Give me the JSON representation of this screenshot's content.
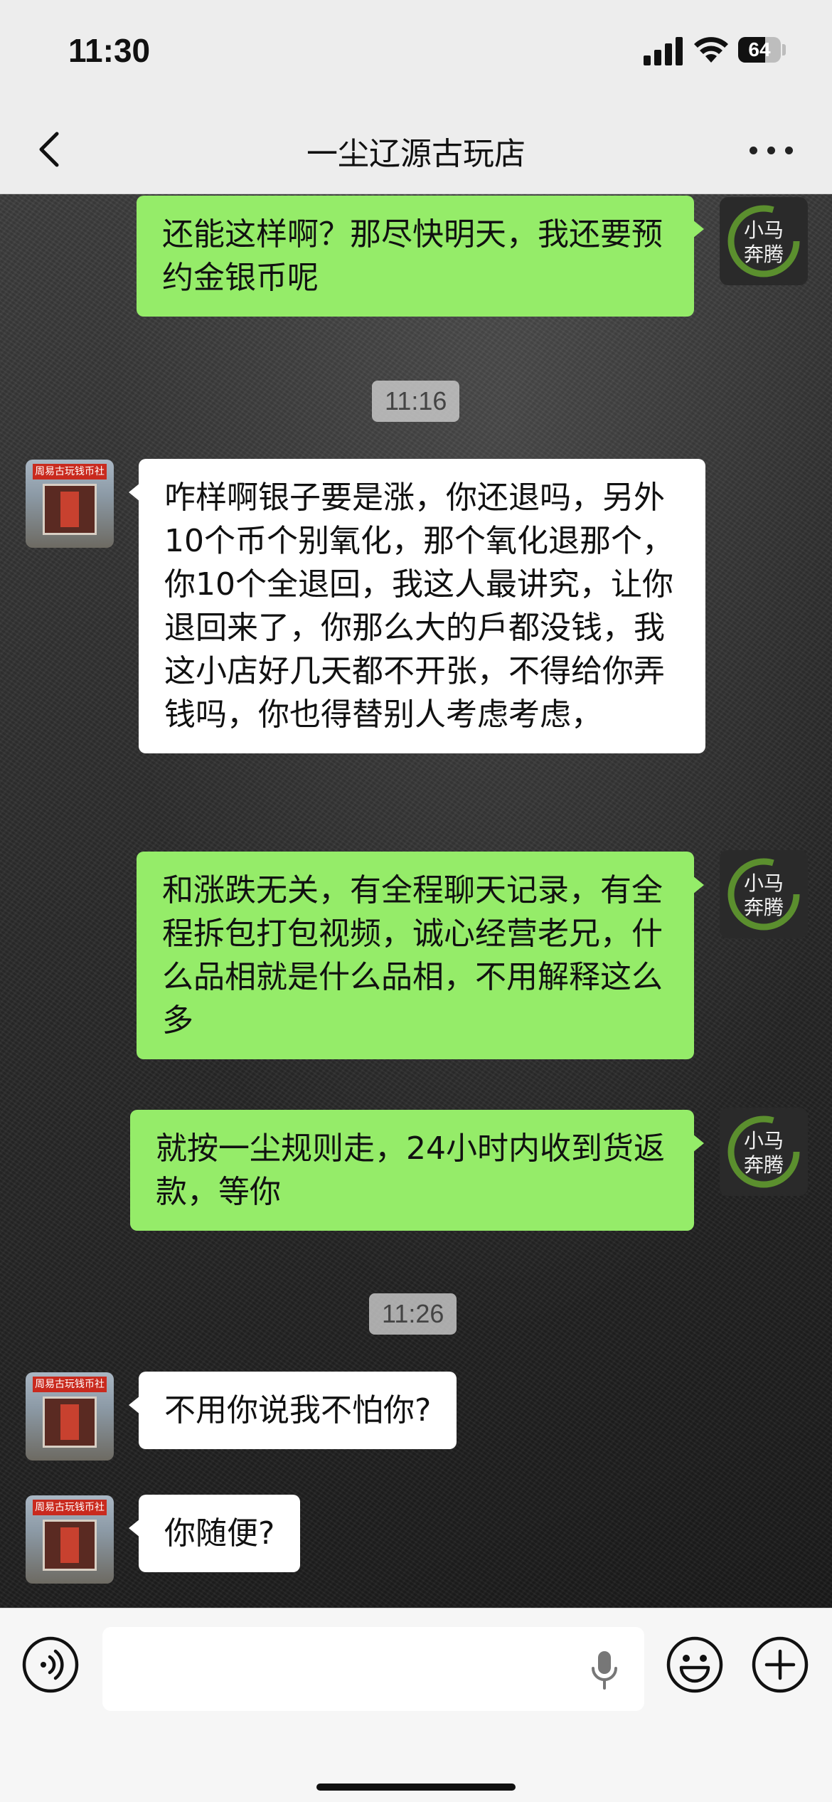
{
  "status_bar": {
    "time": "11:30",
    "battery_level": "64",
    "battery_fraction": 0.64
  },
  "header": {
    "title": "一尘辽源古玩店"
  },
  "colors": {
    "outgoing_bubble": "#95ec69",
    "incoming_bubble": "#ffffff",
    "timestamp_bg": "#d2d2d2",
    "avatar_ring": "#5b8f2e",
    "shop_sign": "#c92a1e"
  },
  "avatars": {
    "me": {
      "text_line1": "小马",
      "text_line2": "奔腾",
      "icon": "ink-circle-avatar"
    },
    "shop": {
      "sign": "周易古玩钱币社",
      "icon": "storefront-photo"
    }
  },
  "messages": [
    {
      "side": "out",
      "text": "还能这样啊？那尽快明天，我还要预约金银币呢"
    },
    {
      "side": "time",
      "text": "11:16"
    },
    {
      "side": "in",
      "text": "咋样啊银子要是涨，你还退吗，另外10个币个别氧化，那个氧化退那个，你10个全退回，我这人最讲究，让你退回来了，你那么大的戶都没钱，我这小店好几天都不开张，不得给你弄钱吗，你也得替别人考虑考虑，"
    },
    {
      "side": "out",
      "text": "和涨跌无关，有全程聊天记录，有全程拆包打包视频，诚心经营老兄，什么品相就是什么品相，不用解释这么多"
    },
    {
      "side": "out",
      "text": "就按一尘规则走，24小时内收到货返款，等你"
    },
    {
      "side": "time",
      "text": "11:26"
    },
    {
      "side": "in",
      "text": "不用你说我不怕你?"
    },
    {
      "side": "in",
      "text": "你随便?"
    }
  ],
  "input_bar": {
    "voice_icon": "voice-toggle-icon",
    "mic_icon": "microphone-icon",
    "emoji_icon": "emoji-icon",
    "plus_icon": "plus-icon"
  }
}
